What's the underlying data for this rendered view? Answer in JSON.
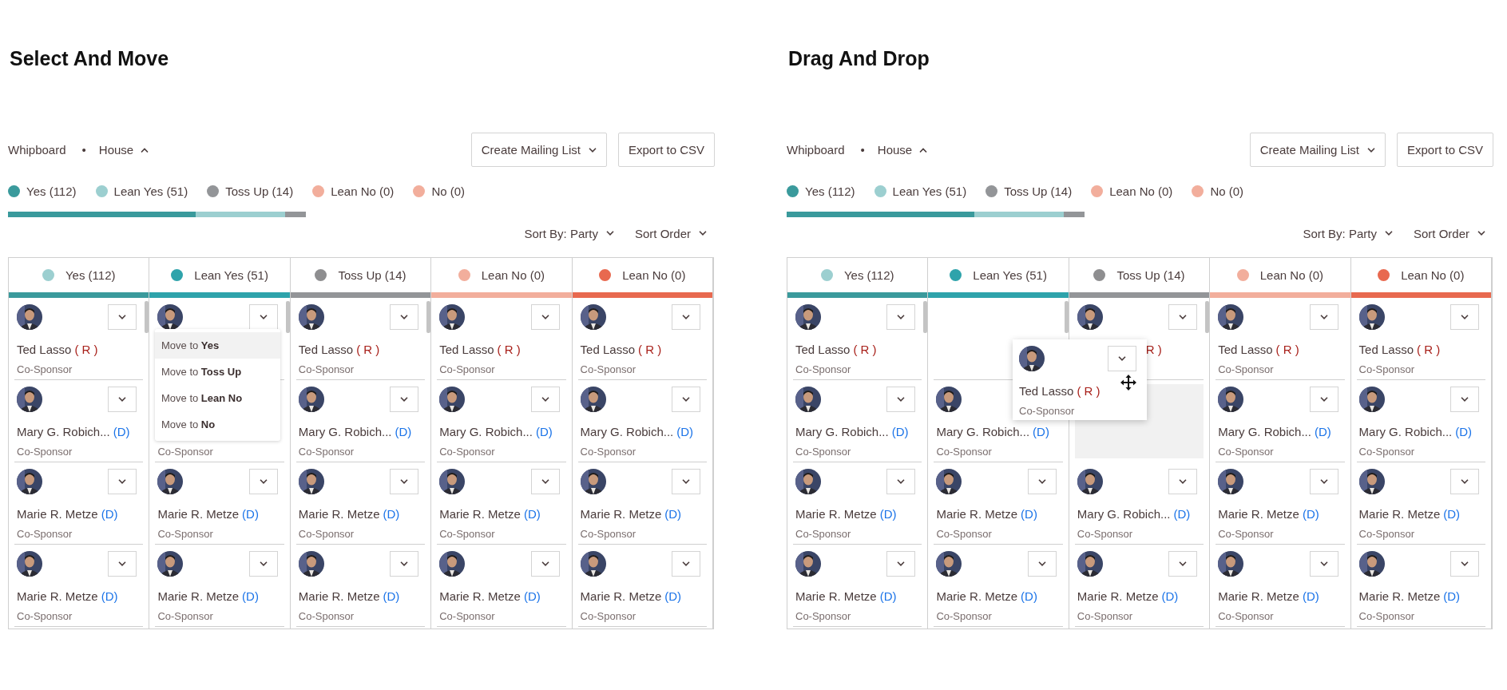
{
  "panels": [
    {
      "title": "Select And Move",
      "breadcrumb": [
        {
          "label": "Whipboard"
        },
        {
          "label": "House",
          "expanded": true
        }
      ],
      "separator": "•",
      "actions": [
        {
          "label": "Create Mailing List",
          "kind": "dropdown"
        },
        {
          "label": "Export to CSV",
          "kind": "plain"
        }
      ],
      "legend": [
        {
          "label": "Yes (112)",
          "color": "#3a9a9c"
        },
        {
          "label": "Lean Yes (51)",
          "color": "#9ccfd0"
        },
        {
          "label": "Toss Up (14)",
          "color": "#939598"
        },
        {
          "label": "Lean No (0)",
          "color": "#f2ae9c"
        },
        {
          "label": "No (0)",
          "color": "#f2ae9c"
        }
      ],
      "progress": [
        {
          "color": "#3a9a9c"
        },
        {
          "color": "#9ccfd0"
        },
        {
          "color": "#939598"
        }
      ],
      "sort": [
        {
          "label": "Sort By: Party"
        },
        {
          "label": "Sort Order"
        }
      ],
      "columns": [
        {
          "label": "Yes (112)",
          "color": "#9ccfd0",
          "bar": {
            "color": "#3a9a9c"
          },
          "scrollable": true,
          "cards": [
            {
              "kind": "member",
              "avatar": true,
              "menu_button": true,
              "name": "Ted Lasso",
              "party": {
                "label": "( R )",
                "color": "#a8201a"
              },
              "role": "Co-Sponsor"
            },
            {
              "kind": "member",
              "avatar": true,
              "menu_button": true,
              "name": "Mary  G. Robich...",
              "party": {
                "label": "(D)",
                "color": "#1a73e8"
              },
              "role": "Co-Sponsor"
            },
            {
              "kind": "member",
              "avatar": true,
              "menu_button": true,
              "name": "Marie R. Metze",
              "party": {
                "label": "(D)",
                "color": "#1a73e8"
              },
              "role": "Co-Sponsor"
            },
            {
              "kind": "member",
              "avatar": true,
              "menu_button": true,
              "name": "Marie R. Metze",
              "party": {
                "label": "(D)",
                "color": "#1a73e8"
              },
              "role": "Co-Sponsor"
            }
          ]
        },
        {
          "label": "Lean Yes (51)",
          "color": "#2ea3ab",
          "bar": {
            "color": "#2ea3ab"
          },
          "scrollable": true,
          "cards": [
            {
              "kind": "member",
              "avatar": true,
              "menu_button": true
            },
            {
              "kind": "member",
              "avatar": false,
              "menu_button": false,
              "role": "Co-Sponsor"
            },
            {
              "kind": "member",
              "avatar": true,
              "menu_button": true,
              "name": "Marie R. Metze",
              "party": {
                "label": "(D)",
                "color": "#1a73e8"
              },
              "role": "Co-Sponsor"
            },
            {
              "kind": "member",
              "avatar": true,
              "menu_button": true,
              "name": "Marie R. Metze",
              "party": {
                "label": "(D)",
                "color": "#1a73e8"
              },
              "role": "Co-Sponsor"
            }
          ]
        },
        {
          "label": "Toss Up (14)",
          "color": "#8e8e90",
          "bar": {
            "color": "#939598"
          },
          "scrollable": true,
          "cards": [
            {
              "kind": "member",
              "avatar": true,
              "menu_button": true,
              "name": "Ted Lasso",
              "party": {
                "label": "( R )",
                "color": "#a8201a"
              },
              "role": "Co-Sponsor"
            },
            {
              "kind": "member",
              "avatar": true,
              "menu_button": true,
              "name": "Mary  G. Robich...",
              "party": {
                "label": "(D)",
                "color": "#1a73e8"
              },
              "role": "Co-Sponsor"
            },
            {
              "kind": "member",
              "avatar": true,
              "menu_button": true,
              "name": "Marie R. Metze",
              "party": {
                "label": "(D)",
                "color": "#1a73e8"
              },
              "role": "Co-Sponsor"
            },
            {
              "kind": "member",
              "avatar": true,
              "menu_button": true,
              "name": "Marie R. Metze",
              "party": {
                "label": "(D)",
                "color": "#1a73e8"
              },
              "role": "Co-Sponsor"
            }
          ]
        },
        {
          "label": "Lean No (0)",
          "color": "#f2ae9c",
          "bar": {
            "color": "#f2ae9c"
          },
          "scrollable": false,
          "cards": [
            {
              "kind": "member",
              "avatar": true,
              "menu_button": true,
              "name": "Ted Lasso",
              "party": {
                "label": "( R )",
                "color": "#a8201a"
              },
              "role": "Co-Sponsor"
            },
            {
              "kind": "member",
              "avatar": true,
              "menu_button": true,
              "name": "Mary  G. Robich...",
              "party": {
                "label": "(D)",
                "color": "#1a73e8"
              },
              "role": "Co-Sponsor"
            },
            {
              "kind": "member",
              "avatar": true,
              "menu_button": true,
              "name": "Marie R. Metze",
              "party": {
                "label": "(D)",
                "color": "#1a73e8"
              },
              "role": "Co-Sponsor"
            },
            {
              "kind": "member",
              "avatar": true,
              "menu_button": true,
              "name": "Marie R. Metze",
              "party": {
                "label": "(D)",
                "color": "#1a73e8"
              },
              "role": "Co-Sponsor"
            }
          ]
        },
        {
          "label": "Lean No (0)",
          "color": "#e8694f",
          "bar": {
            "color": "#e8694f"
          },
          "scrollable": false,
          "cards": [
            {
              "kind": "member",
              "avatar": true,
              "menu_button": true,
              "name": "Ted Lasso",
              "party": {
                "label": "( R )",
                "color": "#a8201a"
              },
              "role": "Co-Sponsor"
            },
            {
              "kind": "member",
              "avatar": true,
              "menu_button": true,
              "name": "Mary  G. Robich...",
              "party": {
                "label": "(D)",
                "color": "#1a73e8"
              },
              "role": "Co-Sponsor"
            },
            {
              "kind": "member",
              "avatar": true,
              "menu_button": true,
              "name": "Marie R. Metze",
              "party": {
                "label": "(D)",
                "color": "#1a73e8"
              },
              "role": "Co-Sponsor"
            },
            {
              "kind": "member",
              "avatar": true,
              "menu_button": true,
              "name": "Marie R. Metze",
              "party": {
                "label": "(D)",
                "color": "#1a73e8"
              },
              "role": "Co-Sponsor"
            }
          ]
        }
      ],
      "menu": {
        "items": [
          {
            "label": "Move to **Yes**",
            "selected": true
          },
          {
            "label": "Move to **Toss Up**",
            "selected": false
          },
          {
            "label": "Move to **Lean No**",
            "selected": false
          },
          {
            "label": "Move to **No**",
            "selected": false
          }
        ]
      }
    },
    {
      "title": "Drag And Drop",
      "breadcrumb": [
        {
          "label": "Whipboard"
        },
        {
          "label": "House",
          "expanded": true
        }
      ],
      "separator": "•",
      "actions": [
        {
          "label": "Create Mailing List",
          "kind": "dropdown"
        },
        {
          "label": "Export to CSV",
          "kind": "plain"
        }
      ],
      "legend": [
        {
          "label": "Yes (112)",
          "color": "#3a9a9c"
        },
        {
          "label": "Lean Yes (51)",
          "color": "#9ccfd0"
        },
        {
          "label": "Toss Up (14)",
          "color": "#939598"
        },
        {
          "label": "Lean No (0)",
          "color": "#f2ae9c"
        },
        {
          "label": "No (0)",
          "color": "#f2ae9c"
        }
      ],
      "progress": [
        {
          "color": "#3a9a9c"
        },
        {
          "color": "#9ccfd0"
        },
        {
          "color": "#939598"
        }
      ],
      "sort": [
        {
          "label": "Sort By: Party"
        },
        {
          "label": "Sort Order"
        }
      ],
      "columns": [
        {
          "label": "Yes (112)",
          "color": "#9ccfd0",
          "bar": {
            "color": "#3a9a9c"
          },
          "scrollable": true,
          "cards": [
            {
              "kind": "member",
              "avatar": true,
              "menu_button": true,
              "name": "Ted Lasso",
              "party": {
                "label": "( R )",
                "color": "#a8201a"
              },
              "role": "Co-Sponsor"
            },
            {
              "kind": "member",
              "avatar": true,
              "menu_button": true,
              "name": "Mary  G. Robich...",
              "party": {
                "label": "(D)",
                "color": "#1a73e8"
              },
              "role": "Co-Sponsor"
            },
            {
              "kind": "member",
              "avatar": true,
              "menu_button": true,
              "name": "Marie R. Metze",
              "party": {
                "label": "(D)",
                "color": "#1a73e8"
              },
              "role": "Co-Sponsor"
            },
            {
              "kind": "member",
              "avatar": true,
              "menu_button": true,
              "name": "Marie R. Metze",
              "party": {
                "label": "(D)",
                "color": "#1a73e8"
              },
              "role": "Co-Sponsor"
            }
          ]
        },
        {
          "label": "Lean Yes (51)",
          "color": "#2ea3ab",
          "bar": {
            "color": "#2ea3ab"
          },
          "scrollable": true,
          "cards": [
            {
              "kind": "gap"
            },
            {
              "kind": "member",
              "avatar": true,
              "menu_button": false,
              "name": "Mary  G. Robich...",
              "party": {
                "label": "(D)",
                "color": "#1a73e8"
              },
              "role": "Co-Sponsor"
            },
            {
              "kind": "member",
              "avatar": true,
              "menu_button": true,
              "name": "Marie R. Metze",
              "party": {
                "label": "(D)",
                "color": "#1a73e8"
              },
              "role": "Co-Sponsor"
            },
            {
              "kind": "member",
              "avatar": true,
              "menu_button": true,
              "name": "Marie R. Metze",
              "party": {
                "label": "(D)",
                "color": "#1a73e8"
              },
              "role": "Co-Sponsor"
            }
          ]
        },
        {
          "label": "Toss Up (14)",
          "color": "#8e8e90",
          "bar": {
            "color": "#939598"
          },
          "scrollable": true,
          "cards": [
            {
              "kind": "member",
              "avatar": true,
              "menu_button": true,
              "party": {
                "label": "R )",
                "color": "#a8201a"
              }
            },
            {
              "kind": "placeholder"
            },
            {
              "kind": "member",
              "avatar": true,
              "menu_button": true,
              "name": "Mary  G. Robich...",
              "party": {
                "label": "(D)",
                "color": "#1a73e8"
              },
              "role": "Co-Sponsor"
            },
            {
              "kind": "member",
              "avatar": true,
              "menu_button": true,
              "name": "Marie R. Metze",
              "party": {
                "label": "(D)",
                "color": "#1a73e8"
              },
              "role": "Co-Sponsor"
            }
          ]
        },
        {
          "label": "Lean No (0)",
          "color": "#f2ae9c",
          "bar": {
            "color": "#f2ae9c"
          },
          "scrollable": false,
          "cards": [
            {
              "kind": "member",
              "avatar": true,
              "menu_button": true,
              "name": "Ted Lasso",
              "party": {
                "label": "( R )",
                "color": "#a8201a"
              },
              "role": "Co-Sponsor"
            },
            {
              "kind": "member",
              "avatar": true,
              "menu_button": true,
              "name": "Mary  G. Robich...",
              "party": {
                "label": "(D)",
                "color": "#1a73e8"
              },
              "role": "Co-Sponsor"
            },
            {
              "kind": "member",
              "avatar": true,
              "menu_button": true,
              "name": "Marie R. Metze",
              "party": {
                "label": "(D)",
                "color": "#1a73e8"
              },
              "role": "Co-Sponsor"
            },
            {
              "kind": "member",
              "avatar": true,
              "menu_button": true,
              "name": "Marie R. Metze",
              "party": {
                "label": "(D)",
                "color": "#1a73e8"
              },
              "role": "Co-Sponsor"
            }
          ]
        },
        {
          "label": "Lean No (0)",
          "color": "#e8694f",
          "bar": {
            "color": "#e8694f"
          },
          "scrollable": false,
          "cards": [
            {
              "kind": "member",
              "avatar": true,
              "menu_button": true,
              "name": "Ted Lasso",
              "party": {
                "label": "( R )",
                "color": "#a8201a"
              },
              "role": "Co-Sponsor"
            },
            {
              "kind": "member",
              "avatar": true,
              "menu_button": true,
              "name": "Mary  G. Robich...",
              "party": {
                "label": "(D)",
                "color": "#1a73e8"
              },
              "role": "Co-Sponsor"
            },
            {
              "kind": "member",
              "avatar": true,
              "menu_button": true,
              "name": "Marie R. Metze",
              "party": {
                "label": "(D)",
                "color": "#1a73e8"
              },
              "role": "Co-Sponsor"
            },
            {
              "kind": "member",
              "avatar": true,
              "menu_button": true,
              "name": "Marie R. Metze",
              "party": {
                "label": "(D)",
                "color": "#1a73e8"
              },
              "role": "Co-Sponsor"
            }
          ]
        }
      ],
      "dragged_card": {
        "kind": "member",
        "avatar": true,
        "menu_button": true,
        "name": "Ted Lasso",
        "party": {
          "label": "( R )",
          "color": "#a8201a"
        },
        "role": "Co-Sponsor"
      }
    }
  ]
}
